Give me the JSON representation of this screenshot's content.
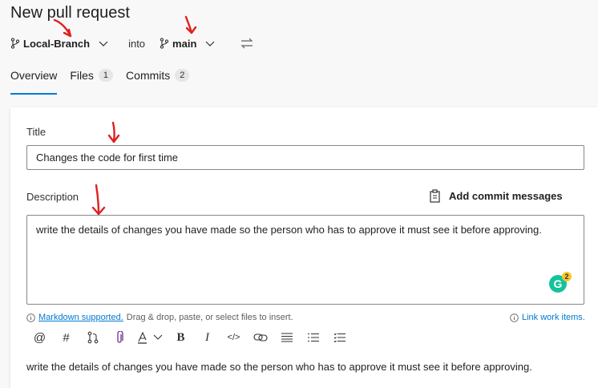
{
  "page": {
    "title": "New pull request"
  },
  "branches": {
    "source": "Local-Branch",
    "into_label": "into",
    "target": "main"
  },
  "tabs": [
    {
      "label": "Overview"
    },
    {
      "label": "Files",
      "count": "1"
    },
    {
      "label": "Commits",
      "count": "2"
    }
  ],
  "form": {
    "title_label": "Title",
    "title_value": "Changes the code for first time",
    "description_label": "Description",
    "add_commit_messages": "Add commit messages",
    "description_value": "write the details of changes you have made so the person who has to approve it must see it before approving.",
    "markdown_link": "Markdown supported.",
    "helper_text": "Drag & drop, paste, or select files to insert.",
    "link_work_items": "Link work items.",
    "grammarly_count": "2",
    "preview": "write the details of changes you have made so the person who has to approve it must see it before approving."
  },
  "toolbar": {
    "icons": [
      "mention-icon",
      "hashtag-icon",
      "pull-request-icon",
      "attachment-icon",
      "highlight-icon",
      "bold-icon",
      "italic-icon",
      "code-icon",
      "link-icon",
      "bulleted-list-icon",
      "numbered-list-icon",
      "checklist-icon"
    ]
  },
  "colors": {
    "accent": "#0078d4",
    "annotation": "#e02020",
    "grammarly": "#15c39a"
  }
}
